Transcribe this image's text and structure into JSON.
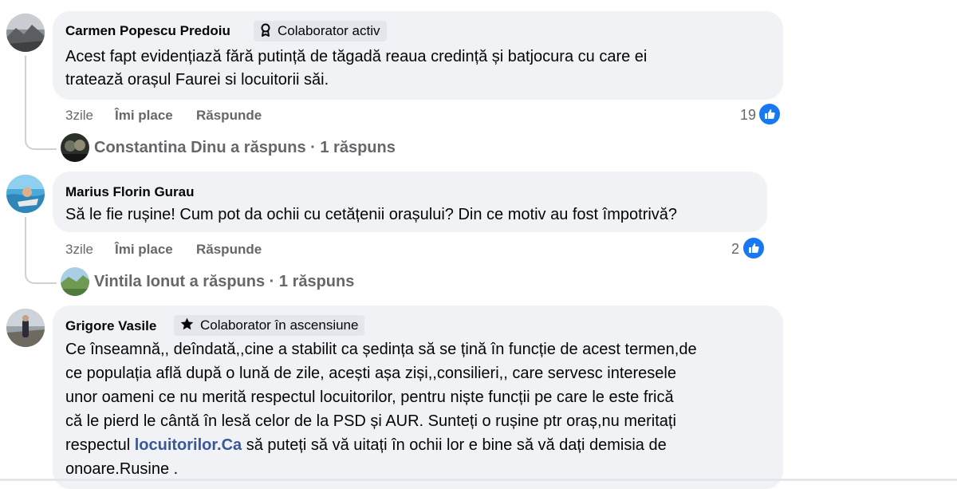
{
  "comments": [
    {
      "author": "Carmen Popescu Predoiu",
      "badge": "Colaborator activ",
      "badge_icon": "ribbon-icon",
      "lines": [
        "Acest fapt evidențiază fără putință de tăgadă reaua credință și batjocura cu care ei",
        "tratează orașul Faurei si locuitorii săi."
      ],
      "time": "3zile",
      "like_label": "Îmi place",
      "reply_label": "Răspunde",
      "reaction_count": "19",
      "replies_summary": "Constantina Dinu a răspuns · 1 răspuns"
    },
    {
      "author": "Marius Florin Gurau",
      "lines": [
        "Să le fie rușine! Cum pot da ochii cu cetățenii orașului? Din ce motiv au fost împotrivă?"
      ],
      "time": "3zile",
      "like_label": "Îmi place",
      "reply_label": "Răspunde",
      "reaction_count": "2",
      "replies_summary": "Vintila Ionut a răspuns · 1 răspuns"
    },
    {
      "author": "Grigore Vasile",
      "badge": "Colaborator în ascensiune",
      "badge_icon": "star-icon",
      "lines": [
        "Ce înseamnă,, deîndată,,cine a stabilit ca ședința să se țină în funcție de acest termen,de",
        "ce populația află după o lună de zile, acești așa ziși,,consilieri,, care servesc interesele",
        "unor oameni ce nu merită respectul locuitorilor, pentru niște funcții pe care le este frică",
        "că le pierd le cântă în lesă celor de la PSD și AUR. Sunteți o rușine ptr oraș,nu meritați"
      ],
      "line5_before": "respectul ",
      "line5_link": "locuitorilor.Ca",
      "line5_after": " să puteți să vă uitați în ochii lor e bine să vă dați demisia de",
      "line6": "onoare.Rusine ."
    }
  ],
  "colors": {
    "bubble": "#f0f2f5",
    "like_blue": "#1877f2",
    "muted": "#65676b",
    "link": "#385898"
  }
}
